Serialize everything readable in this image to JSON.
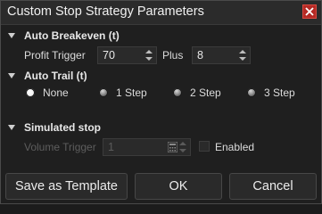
{
  "window": {
    "title": "Custom Stop Strategy Parameters"
  },
  "auto_breakeven": {
    "header": "Auto Breakeven (t)",
    "profit_trigger_label": "Profit Trigger",
    "profit_trigger_value": "70",
    "plus_label": "Plus",
    "plus_value": "8"
  },
  "auto_trail": {
    "header": "Auto Trail (t)",
    "options": [
      "None",
      "1 Step",
      "2 Step",
      "3 Step"
    ],
    "selected": "None"
  },
  "simulated_stop": {
    "header": "Simulated stop",
    "volume_trigger_label": "Volume Trigger",
    "volume_trigger_value": "1",
    "enabled_label": "Enabled",
    "enabled_checked": false
  },
  "buttons": {
    "save_template": "Save as Template",
    "ok": "OK",
    "cancel": "Cancel"
  }
}
